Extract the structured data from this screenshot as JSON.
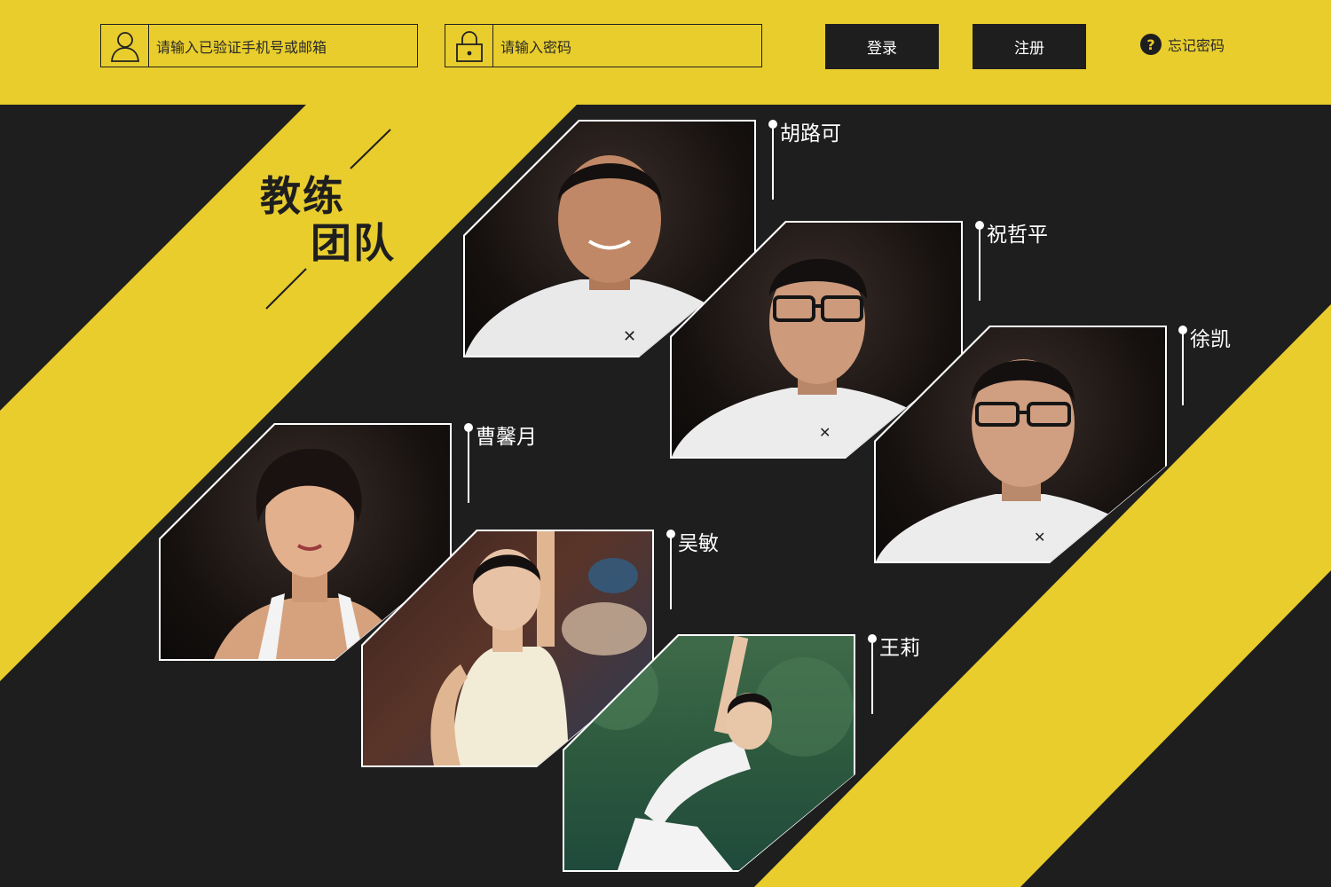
{
  "header": {
    "account_placeholder": "请输入已验证手机号或邮箱",
    "password_placeholder": "请输入密码",
    "login_label": "登录",
    "register_label": "注册",
    "forgot_label": "忘记密码",
    "forgot_icon_glyph": "?"
  },
  "section": {
    "title_line1": "教练",
    "title_line2": "团队"
  },
  "coaches": [
    {
      "name": "胡路可",
      "photo": "male-coach-photo"
    },
    {
      "name": "祝哲平",
      "photo": "male-coach-glasses-photo"
    },
    {
      "name": "徐凯",
      "photo": "male-coach-glasses-photo"
    },
    {
      "name": "曹馨月",
      "photo": "female-coach-portrait-photo"
    },
    {
      "name": "吴敏",
      "photo": "female-dancer-photo"
    },
    {
      "name": "王莉",
      "photo": "female-yoga-outdoor-photo"
    }
  ],
  "colors": {
    "accent_yellow": "#e8cd2d",
    "background_dark": "#1e1e1f",
    "text_white": "#ffffff"
  }
}
